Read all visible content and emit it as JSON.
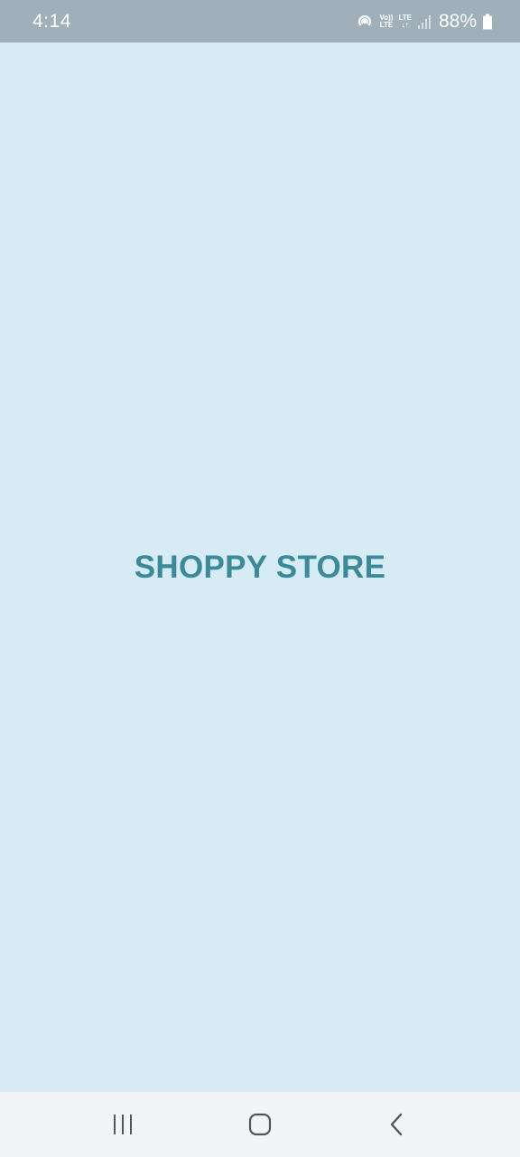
{
  "colors": {
    "accent": "#3a8a99",
    "background": "#d7ebf4",
    "status_bar": "#9fb0ba",
    "nav_bar": "#f3f4f6"
  },
  "status_bar": {
    "time": "4:14",
    "volte_top": "Vo))",
    "volte_bottom": "LTE",
    "lte_top": "LTE",
    "lte_bottom": "↓↑",
    "battery": "88%",
    "icons": [
      "hotspot-icon",
      "volte-icon",
      "lte-data-icon",
      "signal-icon",
      "battery-icon"
    ]
  },
  "main": {
    "title": "SHOPPY STORE"
  },
  "nav_bar": {
    "icons": [
      "recent-apps-icon",
      "home-icon",
      "back-icon"
    ]
  }
}
